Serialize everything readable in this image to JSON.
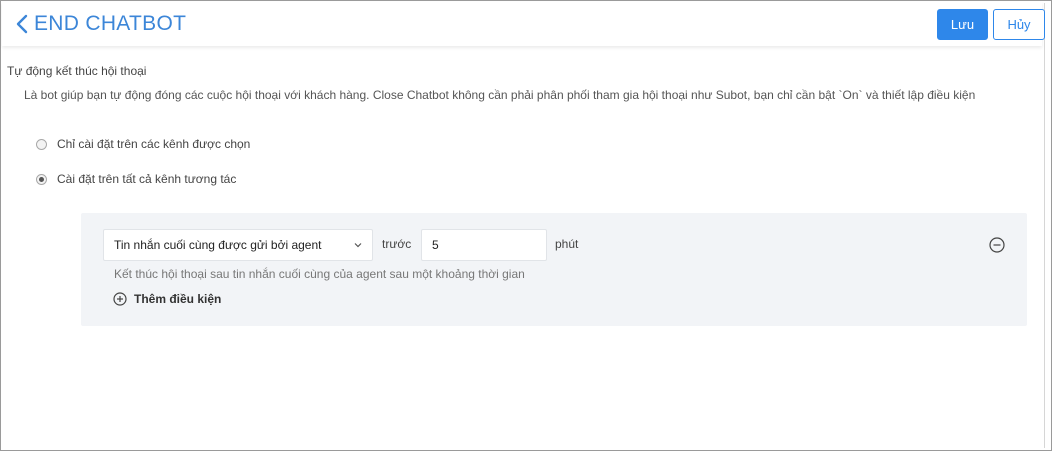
{
  "header": {
    "title": "END CHATBOT",
    "save_label": "Lưu",
    "cancel_label": "Hủy"
  },
  "settings": {
    "section_title": "Tự động kết thúc hội thoại",
    "description": "Là bot giúp bạn tự động đóng các cuộc hội thoại với khách hàng. Close Chatbot không cần phải phân phối tham gia hội thoại như Subot, bạn chỉ cần bật `On` và thiết lập điều kiện",
    "radio_options": [
      {
        "label": "Chỉ cài đặt trên các kênh được chọn",
        "checked": false
      },
      {
        "label": "Cài đặt trên tất cả kênh tương tác",
        "checked": true
      }
    ]
  },
  "condition": {
    "selected_trigger": "Tin nhắn cuối cùng được gửi bởi agent",
    "before_label": "trước",
    "value": "5",
    "unit_label": "phút",
    "hint": "Kết thúc hội thoại sau tin nhắn cuối cùng của agent sau một khoảng thời gian",
    "add_condition_label": "Thêm điều kiện"
  },
  "colors": {
    "accent": "#2e87ea",
    "title": "#3c86d8",
    "panel_bg": "#f2f4f7"
  },
  "icons": {
    "back": "chevron-left-icon",
    "dropdown": "chevron-down-icon",
    "add": "plus-circle-icon",
    "remove": "minus-circle-icon"
  }
}
